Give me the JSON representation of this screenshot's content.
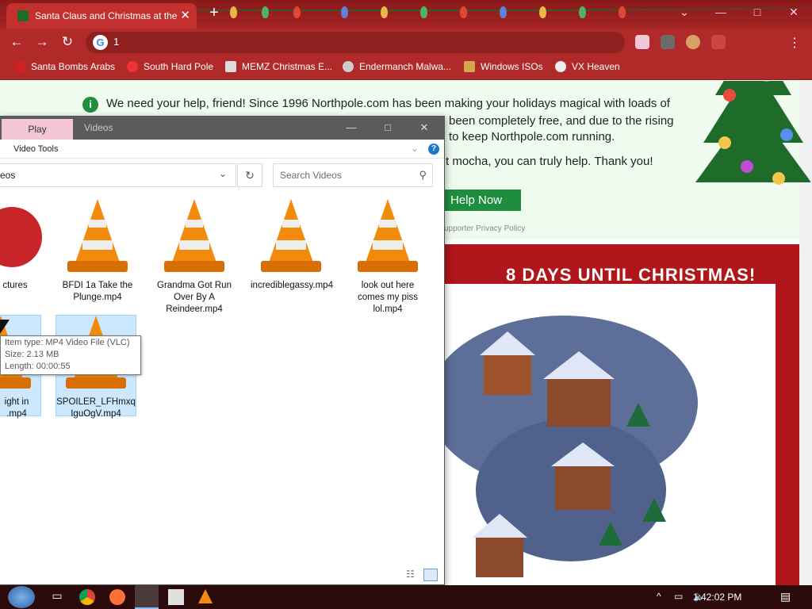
{
  "browser": {
    "tab_title": "Santa Claus and Christmas at the",
    "tab_close": "✕",
    "new_tab": "+",
    "omnibox_text": "1",
    "bookmarks": [
      {
        "label": "Santa Bombs Arabs",
        "icon": "bookmark-santa-icon"
      },
      {
        "label": "South Hard Pole",
        "icon": "bookmark-snowflake-icon"
      },
      {
        "label": "MEMZ Christmas E...",
        "icon": "bookmark-memz-icon"
      },
      {
        "label": "Endermanch Malwa...",
        "icon": "bookmark-endermanch-icon"
      },
      {
        "label": "Windows ISOs",
        "icon": "bookmark-windows-icon"
      },
      {
        "label": "VX Heaven",
        "icon": "bookmark-vx-icon"
      }
    ]
  },
  "webpage": {
    "banner_line1": "We need your help, friend! Since 1996 Northpole.com has been making your holidays magical with loads of",
    "banner_line2": "been completely free, and due to the rising",
    "banner_line3": "to keep Northpole.com running.",
    "banner_line4": "t mocha, you can truly help. Thank you!",
    "help_button": "Help Now",
    "privacy_text": "upporter Privacy Policy",
    "countdown": "8 DAYS UNTIL CHRISTMAS!"
  },
  "explorer": {
    "tab_play": "Play",
    "tab_videos": "Videos",
    "video_tools": "Video Tools",
    "address_text": "eos",
    "search_placeholder": "Search Videos",
    "files": [
      {
        "name": "ctures",
        "type": "folder"
      },
      {
        "name": "BFDI 1a Take the Plunge.mp4",
        "type": "vlc"
      },
      {
        "name": "Grandma Got Run Over By A Reindeer.mp4",
        "type": "vlc"
      },
      {
        "name": "incrediblegassy.mp4",
        "type": "vlc"
      },
      {
        "name": "look out here comes my piss lol.mp4",
        "type": "vlc"
      },
      {
        "name": "ight in\n.mp4",
        "type": "vlc"
      },
      {
        "name": "SPOILER_LFHmxqIguOgV.mp4",
        "type": "vlc"
      }
    ],
    "tooltip": {
      "type": "Item type: MP4 Video File (VLC)",
      "size": "Size: 2.13 MB",
      "length": "Length: 00:00:55"
    }
  },
  "taskbar": {
    "clock": "1:42:02 PM"
  },
  "colors": {
    "chrome_red": "#b12a2a",
    "help_green": "#1e8e3e",
    "vlc_orange": "#f28a0c",
    "selection_blue": "#cce8ff"
  }
}
